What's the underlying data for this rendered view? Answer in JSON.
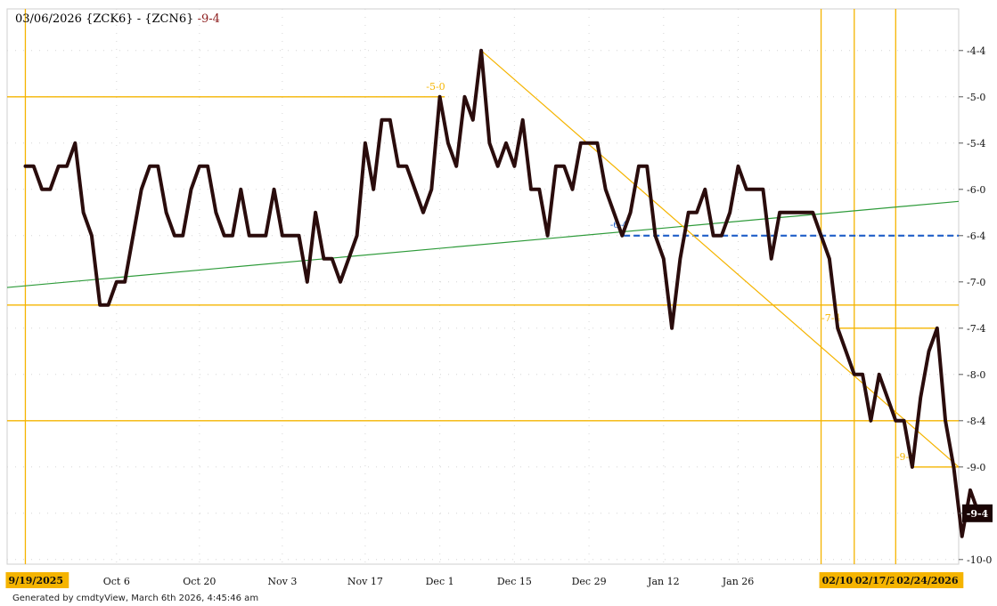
{
  "header": {
    "date": "03/06/2026",
    "symbols": "{ZCK6} - {ZCN6}",
    "last": "-9-4"
  },
  "footer": {
    "generated": "Generated by cmdtyView, March 6th 2026, 4:45:46 am"
  },
  "chart_data": {
    "type": "line",
    "title": "03/06/2026 {ZCK6} - {ZCN6} -9-4",
    "x_unit": "trading day index",
    "x_tick_labels": [
      {
        "day": 0,
        "label": "9/19/2025",
        "highlight": true
      },
      {
        "day": 11,
        "label": "Oct 6",
        "highlight": false
      },
      {
        "day": 21,
        "label": "Oct 20",
        "highlight": false
      },
      {
        "day": 31,
        "label": "Nov 3",
        "highlight": false
      },
      {
        "day": 41,
        "label": "Nov 17",
        "highlight": false
      },
      {
        "day": 50,
        "label": "Dec 1",
        "highlight": false
      },
      {
        "day": 59,
        "label": "Dec 15",
        "highlight": false
      },
      {
        "day": 68,
        "label": "Dec 29",
        "highlight": false
      },
      {
        "day": 77,
        "label": "Jan 12",
        "highlight": false
      },
      {
        "day": 86,
        "label": "Jan 26",
        "highlight": false
      },
      {
        "day": 96,
        "label": "02/10/",
        "highlight": true
      },
      {
        "day": 100,
        "label": "02/17/2",
        "highlight": true
      },
      {
        "day": 105,
        "label": "02/24/2026",
        "highlight": true
      }
    ],
    "y_tick_labels": [
      "-4-4",
      "-5-0",
      "-5-4",
      "-6-0",
      "-6-4",
      "-7-0",
      "-7-4",
      "-8-0",
      "-8-4",
      "-9-0",
      "-9-4",
      "-10-0"
    ],
    "y_tick_values": [
      -4.5,
      -5.0,
      -5.5,
      -6.0,
      -6.5,
      -7.0,
      -7.5,
      -8.0,
      -8.5,
      -9.0,
      -9.5,
      -10.0
    ],
    "ylim": [
      -10.05,
      -4.05
    ],
    "xlim": [
      -2.2,
      112.6
    ],
    "series": [
      {
        "color": "#2a0c0c",
        "points": [
          [
            0,
            -5.75
          ],
          [
            1,
            -5.75
          ],
          [
            2,
            -6.0
          ],
          [
            3,
            -6.0
          ],
          [
            4,
            -5.75
          ],
          [
            5,
            -5.75
          ],
          [
            6,
            -5.5
          ],
          [
            7,
            -6.25
          ],
          [
            8,
            -6.5
          ],
          [
            9,
            -7.25
          ],
          [
            10,
            -7.25
          ],
          [
            11,
            -7.0
          ],
          [
            12,
            -7.0
          ],
          [
            13,
            -6.5
          ],
          [
            14,
            -6.0
          ],
          [
            15,
            -5.75
          ],
          [
            16,
            -5.75
          ],
          [
            17,
            -6.25
          ],
          [
            18,
            -6.5
          ],
          [
            19,
            -6.5
          ],
          [
            20,
            -6.0
          ],
          [
            21,
            -5.75
          ],
          [
            22,
            -5.75
          ],
          [
            23,
            -6.25
          ],
          [
            24,
            -6.5
          ],
          [
            25,
            -6.5
          ],
          [
            26,
            -6.0
          ],
          [
            27,
            -6.5
          ],
          [
            28,
            -6.5
          ],
          [
            29,
            -6.5
          ],
          [
            30,
            -6.0
          ],
          [
            31,
            -6.5
          ],
          [
            32,
            -6.5
          ],
          [
            33,
            -6.5
          ],
          [
            34,
            -7.0
          ],
          [
            35,
            -6.25
          ],
          [
            36,
            -6.75
          ],
          [
            37,
            -6.75
          ],
          [
            38,
            -7.0
          ],
          [
            39,
            -6.75
          ],
          [
            40,
            -6.5
          ],
          [
            41,
            -5.5
          ],
          [
            42,
            -6.0
          ],
          [
            43,
            -5.25
          ],
          [
            44,
            -5.25
          ],
          [
            45,
            -5.75
          ],
          [
            46,
            -5.75
          ],
          [
            47,
            -6.0
          ],
          [
            48,
            -6.25
          ],
          [
            49,
            -6.0
          ],
          [
            50,
            -5.0
          ],
          [
            51,
            -5.5
          ],
          [
            52,
            -5.75
          ],
          [
            53,
            -5.0
          ],
          [
            54,
            -5.25
          ],
          [
            55,
            -4.5
          ],
          [
            56,
            -5.5
          ],
          [
            57,
            -5.75
          ],
          [
            58,
            -5.5
          ],
          [
            59,
            -5.75
          ],
          [
            60,
            -5.25
          ],
          [
            61,
            -6.0
          ],
          [
            62,
            -6.0
          ],
          [
            63,
            -6.5
          ],
          [
            64,
            -5.75
          ],
          [
            65,
            -5.75
          ],
          [
            66,
            -6.0
          ],
          [
            67,
            -5.5
          ],
          [
            68,
            -5.5
          ],
          [
            69,
            -5.5
          ],
          [
            70,
            -6.0
          ],
          [
            71,
            -6.25
          ],
          [
            72,
            -6.5
          ],
          [
            73,
            -6.25
          ],
          [
            74,
            -5.75
          ],
          [
            75,
            -5.75
          ],
          [
            76,
            -6.5
          ],
          [
            77,
            -6.75
          ],
          [
            78,
            -7.5
          ],
          [
            79,
            -6.75
          ],
          [
            80,
            -6.25
          ],
          [
            81,
            -6.25
          ],
          [
            82,
            -6.0
          ],
          [
            83,
            -6.5
          ],
          [
            84,
            -6.5
          ],
          [
            85,
            -6.25
          ],
          [
            86,
            -5.75
          ],
          [
            87,
            -6.0
          ],
          [
            88,
            -6.0
          ],
          [
            89,
            -6.0
          ],
          [
            90,
            -6.75
          ],
          [
            91,
            -6.25
          ],
          [
            92,
            -6.25
          ],
          [
            93,
            -6.25
          ],
          [
            94,
            -6.25
          ],
          [
            95,
            -6.25
          ],
          [
            96,
            -6.5
          ],
          [
            97,
            -6.75
          ],
          [
            98,
            -7.5
          ],
          [
            99,
            -7.75
          ],
          [
            100,
            -8.0
          ],
          [
            101,
            -8.0
          ],
          [
            102,
            -8.5
          ],
          [
            103,
            -8.0
          ],
          [
            104,
            -8.25
          ],
          [
            105,
            -8.5
          ],
          [
            106,
            -8.5
          ],
          [
            107,
            -9.0
          ],
          [
            108,
            -8.25
          ],
          [
            109,
            -7.75
          ],
          [
            110,
            -7.5
          ],
          [
            111,
            -8.5
          ],
          [
            112,
            -9.0
          ],
          [
            113,
            -9.75
          ],
          [
            114,
            -9.25
          ],
          [
            115,
            -9.5
          ]
        ]
      }
    ],
    "last_value_label": "-9-4",
    "last_value": -9.5,
    "annotations": [
      {
        "kind": "hline",
        "y": -5.0,
        "x_from": -2.2,
        "x_to": 50.6,
        "label": "-5-0",
        "label_day": 49.5
      },
      {
        "kind": "hline",
        "y": -7.25,
        "x_from": -2.2,
        "x_to": 112.6,
        "label": "",
        "label_day": null
      },
      {
        "kind": "hline",
        "y": -8.5,
        "x_from": -2.2,
        "x_to": 112.6,
        "label": "",
        "label_day": null
      },
      {
        "kind": "hline",
        "y": -7.5,
        "x_from": 98.2,
        "x_to": 110.2,
        "label": "-7-4",
        "label_day": 97.2
      },
      {
        "kind": "hline",
        "y": -9.0,
        "x_from": 107.0,
        "x_to": 112.6,
        "label": "-9-0",
        "label_day": 106.2
      },
      {
        "kind": "hline_dashed",
        "y": -6.5,
        "x_from": 72.2,
        "x_to": 112.6,
        "label": "-6-4",
        "label_day": 71.6
      }
    ],
    "trendlines": [
      {
        "color": "#2e9b3a",
        "from": [
          -2.2,
          -7.06
        ],
        "to": [
          112.6,
          -6.13
        ]
      },
      {
        "color": "#f5b400",
        "from": [
          55.0,
          -4.5
        ],
        "to": [
          112.6,
          -9.0
        ]
      }
    ],
    "vlines_days": [
      0,
      96,
      100,
      105
    ],
    "colors": {
      "series": "#2a0c0c",
      "annotation": "#f5b400",
      "trend_green": "#2e9b3a",
      "dashed": "#1f5fc8",
      "last_badge_bg": "#1a0505",
      "last_badge_fg": "#ffffff"
    }
  }
}
